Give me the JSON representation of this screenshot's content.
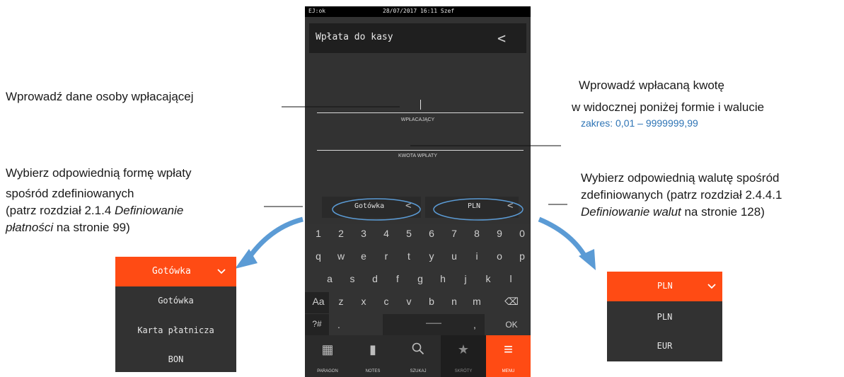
{
  "phone": {
    "status": {
      "ej": "EJ:ok",
      "datetime": "28/07/2017 16:11 Szef"
    },
    "title": "Wpłata do kasy",
    "back_glyph": "<",
    "fields": {
      "payer_caption": "WPŁACAJĄCY",
      "amount_caption": "KWOTA WPŁATY"
    },
    "payment_form": {
      "value": "Gotówka",
      "chevron": "<"
    },
    "currency": {
      "value": "PLN",
      "chevron": "<"
    },
    "keyboard": {
      "row1": [
        "1",
        "2",
        "3",
        "4",
        "5",
        "6",
        "7",
        "8",
        "9",
        "0"
      ],
      "row2": [
        "q",
        "w",
        "e",
        "r",
        "t",
        "y",
        "u",
        "i",
        "o",
        "p"
      ],
      "row3": [
        "a",
        "s",
        "d",
        "f",
        "g",
        "h",
        "j",
        "k",
        "l"
      ],
      "row4": [
        "Aa",
        "z",
        "x",
        "c",
        "v",
        "b",
        "n",
        "m",
        "⌫"
      ],
      "row5": {
        "sym": "?#",
        "dot": ".",
        "space": "——",
        "comma": ",",
        "ok": "OK"
      }
    },
    "bottom_nav": [
      {
        "icon": "receipt-icon",
        "label": "PARAGON"
      },
      {
        "icon": "notes-icon",
        "label": "NOTES"
      },
      {
        "icon": "search-icon",
        "label": "SZUKAJ"
      },
      {
        "icon": "star-icon",
        "label": "SKRÓTY"
      },
      {
        "icon": "menu-icon",
        "label": "MENU"
      }
    ],
    "accent": "#ff4b14",
    "highlight_ellipse": "#5b9bd5"
  },
  "annotations": {
    "payer": "Wprowadź dane osoby wpłacającej",
    "amount_line1": "Wprowadź wpłacaną kwotę",
    "amount_line2": "w widocznej poniżej formie i walucie",
    "range": "zakres: 0,01 – 9999999,99",
    "form_line1": "Wybierz odpowiednią formę wpłaty",
    "form_line2": "spośród zdefiniowanych",
    "form_line3_a": "(patrz rozdział 2.1.4 ",
    "form_line3_b": "Definiowanie",
    "form_line4_a": "płatności",
    "form_line4_b": " na stronie 99)",
    "curr_line1": "Wybierz odpowiednią walutę spośród",
    "curr_line2": "zdefiniowanych (patrz rozdział 2.4.4.1",
    "curr_line3_a": "Definiowanie walut",
    "curr_line3_b": " na stronie 128)"
  },
  "dropdown_form": {
    "selected": "Gotówka",
    "options": [
      "Gotówka",
      "Karta płatnicza",
      "BON"
    ]
  },
  "dropdown_currency": {
    "selected": "PLN",
    "options": [
      "PLN",
      "EUR"
    ]
  }
}
